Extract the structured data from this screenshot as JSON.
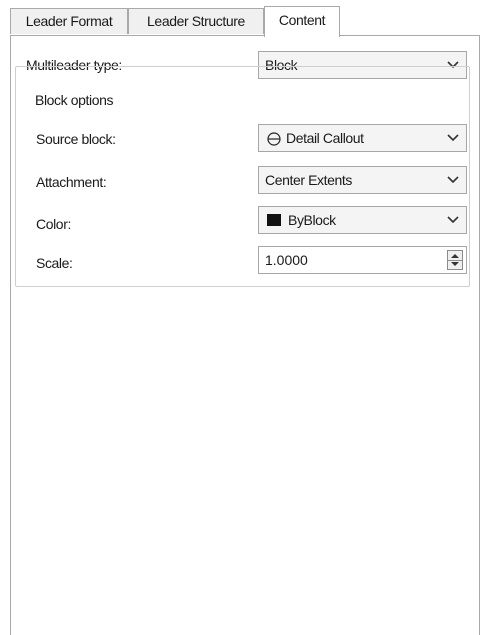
{
  "tabs": [
    {
      "label": "Leader Format",
      "active": false
    },
    {
      "label": "Leader Structure",
      "active": false
    },
    {
      "label": "Content",
      "active": true
    }
  ],
  "content": {
    "multileader_type": {
      "label": "Multileader type:",
      "value": "Block"
    },
    "block_options": {
      "title": "Block options",
      "source_block": {
        "label": "Source block:",
        "value": "Detail Callout",
        "icon": "circle-block-icon"
      },
      "attachment": {
        "label": "Attachment:",
        "value": "Center Extents"
      },
      "color": {
        "label": "Color:",
        "value": "ByBlock",
        "swatch": "#111111"
      },
      "scale": {
        "label": "Scale:",
        "value": "1.0000"
      }
    }
  }
}
